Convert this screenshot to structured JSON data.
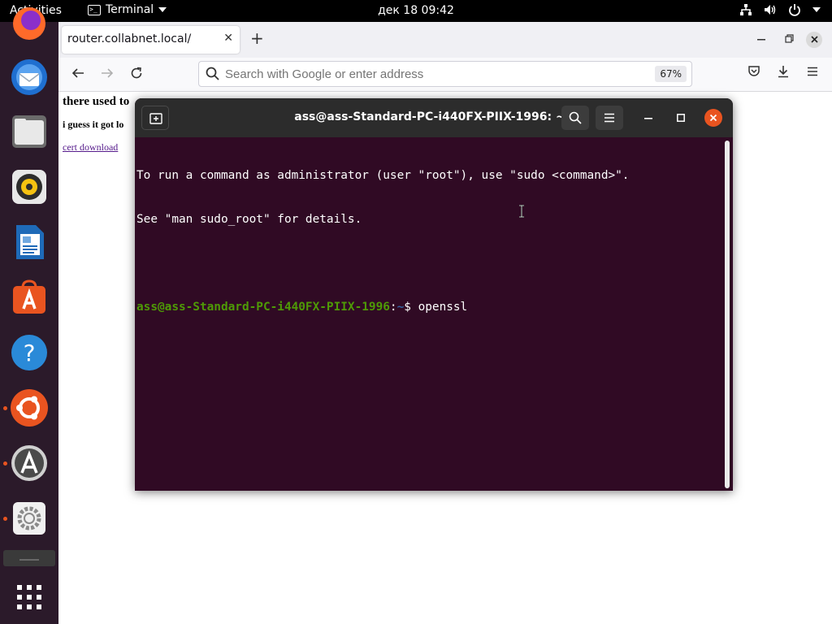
{
  "topbar": {
    "activities": "Activities",
    "app_name": "Terminal",
    "clock": "дек 18  09:42",
    "icons": [
      "network-icon",
      "volume-icon",
      "power-icon",
      "chevron-down-icon"
    ]
  },
  "dock": {
    "items": [
      {
        "name": "firefox",
        "icon": "firefox-icon"
      },
      {
        "name": "thunderbird",
        "icon": "thunderbird-icon"
      },
      {
        "name": "files",
        "icon": "files-icon"
      },
      {
        "name": "rhythmbox",
        "icon": "rhythmbox-icon"
      },
      {
        "name": "libreoffice-writer",
        "icon": "writer-icon"
      },
      {
        "name": "ubuntu-software",
        "icon": "software-icon"
      },
      {
        "name": "help",
        "icon": "help-icon"
      },
      {
        "name": "ubuntu",
        "icon": "ubuntu-icon"
      },
      {
        "name": "software-updater",
        "icon": "updater-icon"
      },
      {
        "name": "settings",
        "icon": "settings-icon"
      },
      {
        "name": "trash",
        "icon": "trash-icon"
      },
      {
        "name": "show-apps",
        "icon": "app-grid-icon"
      }
    ]
  },
  "browser": {
    "tab_title": "router.collabnet.local/",
    "tab_close": "✕",
    "new_tab": "+",
    "url_placeholder": "Search with Google or enter address",
    "zoom": "67%",
    "page": {
      "heading": "there used to",
      "paragraph": "i guess it got lo",
      "link": "cert download"
    }
  },
  "terminal": {
    "title": "ass@ass-Standard-PC-i440FX-PIIX-1996: ~",
    "lines": {
      "line1": "To run a command as administrator (user \"root\"), use \"sudo <command>\".",
      "line2": "See \"man sudo_root\" for details."
    },
    "prompt": {
      "user_host": "ass@ass-Standard-PC-i440FX-PIIX-1996",
      "sep": ":",
      "path": "~",
      "symbol": "$ ",
      "command": "openssl"
    }
  },
  "colors": {
    "terminal_bg": "#300a24",
    "prompt_user": "#4e9a06",
    "prompt_path": "#3465a4",
    "accent": "#e95420",
    "dock_bg": "#2b1a2a"
  }
}
